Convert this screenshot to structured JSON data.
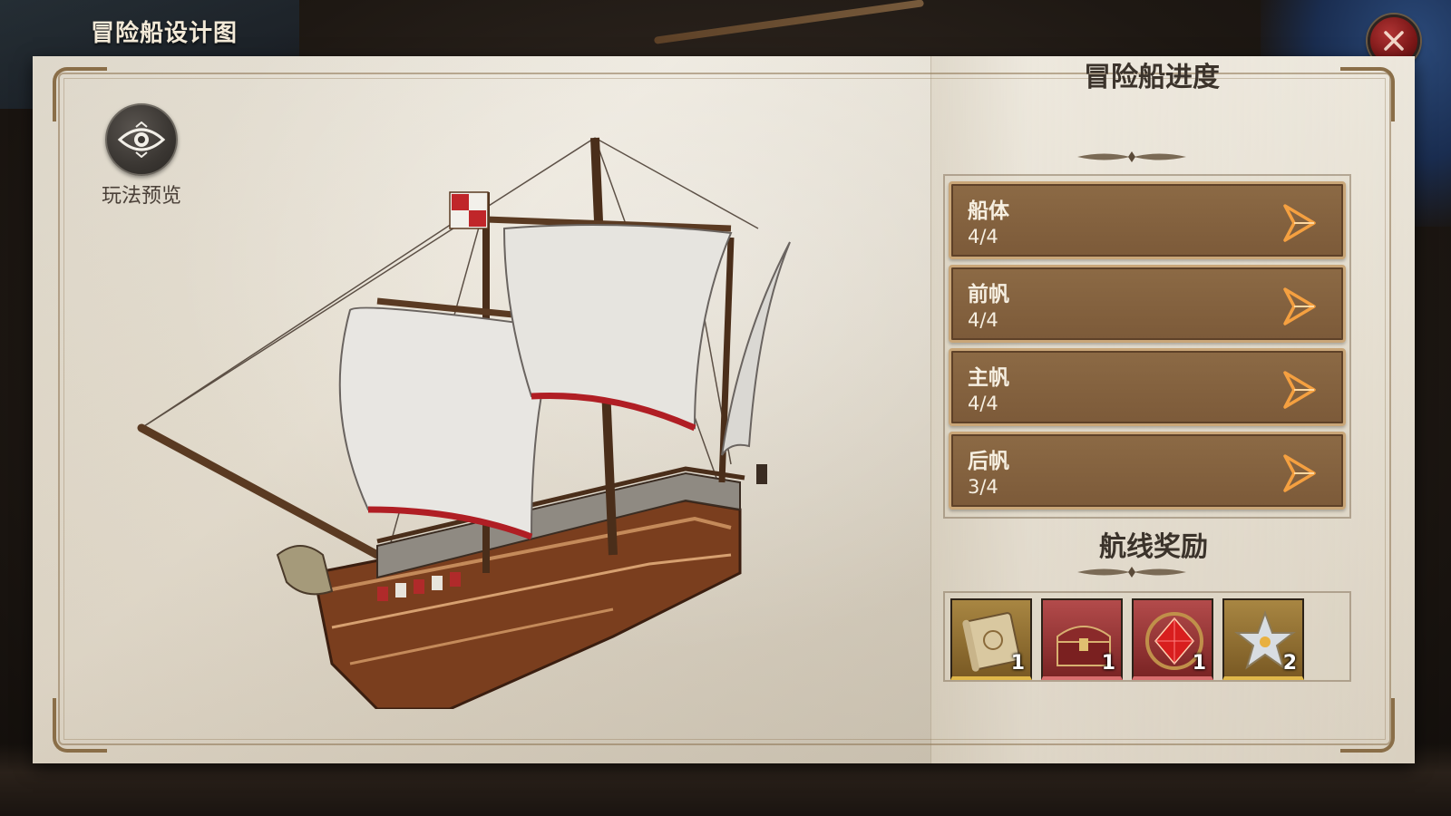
{
  "window": {
    "title": "冒险船设计图"
  },
  "preview": {
    "label": "玩法预览",
    "icon": "eye-icon"
  },
  "progress": {
    "title": "冒险船进度",
    "rows": [
      {
        "name": "船体",
        "value": "4/4"
      },
      {
        "name": "前帆",
        "value": "4/4"
      },
      {
        "name": "主帆",
        "value": "4/4"
      },
      {
        "name": "后帆",
        "value": "3/4"
      }
    ]
  },
  "rewards": {
    "title": "航线奖励",
    "items": [
      {
        "icon": "scroll-map-icon",
        "count": "1",
        "rarity": "gold"
      },
      {
        "icon": "treasure-chest-icon",
        "count": "1",
        "rarity": "red"
      },
      {
        "icon": "red-gem-icon",
        "count": "1",
        "rarity": "red"
      },
      {
        "icon": "crystal-star-icon",
        "count": "2",
        "rarity": "gold"
      }
    ]
  },
  "colors": {
    "row_bg": "#8c6a45",
    "row_border": "#c9a678",
    "parchment": "#e4ddcf",
    "close_red": "#9a2626",
    "accent_orange": "#f0a040"
  }
}
